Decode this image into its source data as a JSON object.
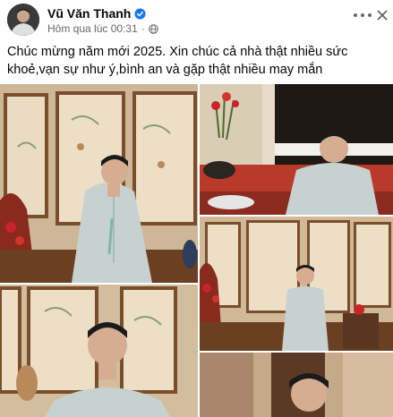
{
  "post": {
    "author": "Vũ Văn Thanh",
    "timestamp": "Hôm qua lúc 00:31",
    "caption": "Chúc mừng năm mới 2025. Xin chúc cả nhà thật nhiều sức khoẻ,vạn sự như ý,bình an và gặp thật nhiều may mắn"
  },
  "icons": {
    "verified": "verified-badge-icon",
    "privacy": "globe-icon",
    "more": "more-options-icon",
    "close": "close-icon"
  },
  "colors": {
    "verified": "#1877f2",
    "meta_text": "#65676b",
    "ao_dai": "#c9d3d2",
    "wall": "#e8d9c4",
    "flowers_red": "#c8242a"
  }
}
